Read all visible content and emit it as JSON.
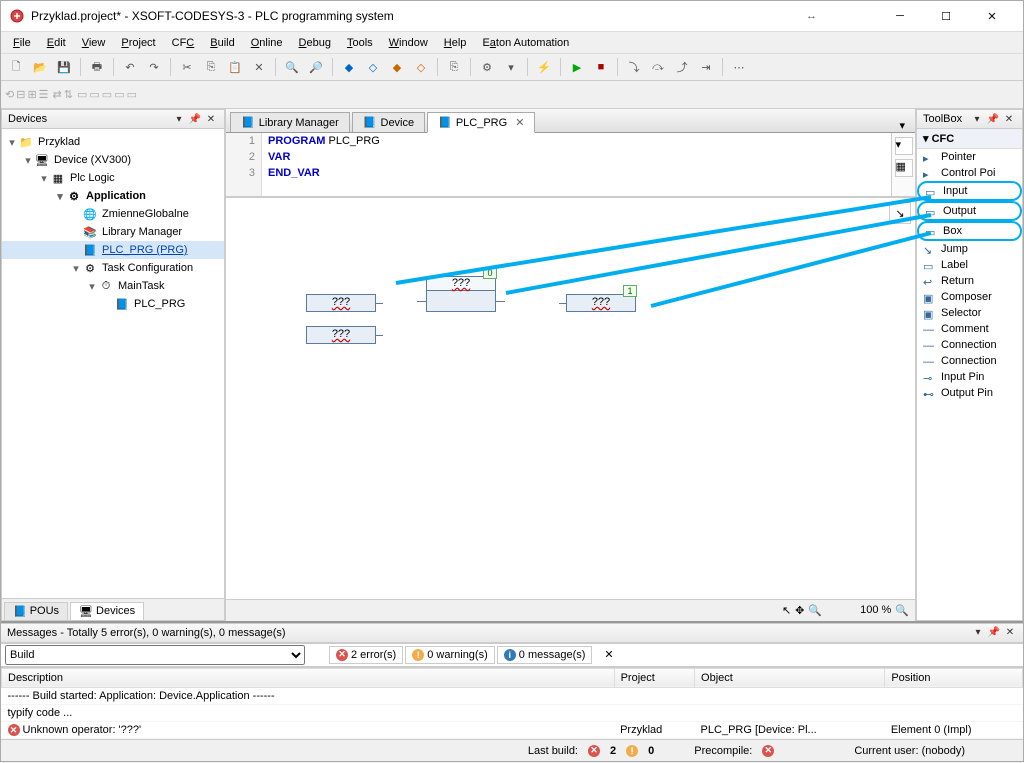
{
  "window": {
    "title": "Przyklad.project* - XSOFT-CODESYS-3 - PLC programming system"
  },
  "menus": [
    "File",
    "Edit",
    "View",
    "Project",
    "CFC",
    "Build",
    "Online",
    "Debug",
    "Tools",
    "Window",
    "Help",
    "Eaton Automation"
  ],
  "devices": {
    "title": "Devices",
    "tree": [
      {
        "label": "Przyklad",
        "indent": 0,
        "icon": "project",
        "tw": "▾"
      },
      {
        "label": "Device (XV300)",
        "indent": 1,
        "icon": "device",
        "tw": "▾"
      },
      {
        "label": "Plc Logic",
        "indent": 2,
        "icon": "plc",
        "tw": "▾"
      },
      {
        "label": "Application",
        "indent": 3,
        "icon": "app",
        "tw": "▾",
        "bold": true
      },
      {
        "label": "ZmienneGlobalne",
        "indent": 4,
        "icon": "globe",
        "tw": ""
      },
      {
        "label": "Library Manager",
        "indent": 4,
        "icon": "lib",
        "tw": ""
      },
      {
        "label": "PLC_PRG (PRG)",
        "indent": 4,
        "icon": "pou",
        "tw": "",
        "selected": true,
        "link": true
      },
      {
        "label": "Task Configuration",
        "indent": 4,
        "icon": "task",
        "tw": "▾"
      },
      {
        "label": "MainTask",
        "indent": 5,
        "icon": "mtask",
        "tw": "▾"
      },
      {
        "label": "PLC_PRG",
        "indent": 6,
        "icon": "pou",
        "tw": ""
      }
    ],
    "tabs": [
      "POUs",
      "Devices"
    ]
  },
  "editor": {
    "tabs": [
      {
        "label": "Library Manager",
        "active": false
      },
      {
        "label": "Device",
        "active": false
      },
      {
        "label": "PLC_PRG",
        "active": true,
        "closable": true
      }
    ],
    "code": {
      "lines": [
        {
          "n": 1,
          "html": "<span class='kw-blue'>PROGRAM</span> PLC_PRG"
        },
        {
          "n": 2,
          "html": "<span class='kw-blue'>VAR</span>"
        },
        {
          "n": 3,
          "html": "<span class='kw-blue'>END_VAR</span>"
        }
      ]
    },
    "blocks": {
      "input1": "???",
      "input2": "???",
      "box": "???",
      "boxBadge": "0",
      "output": "???",
      "outBadge": "1"
    },
    "zoom": "100 %"
  },
  "canvas_tools": {
    "pointer": "↖",
    "move": "✥",
    "zoom": "🔍"
  },
  "toolbox": {
    "title": "ToolBox",
    "group": "CFC",
    "items": [
      {
        "label": "Pointer",
        "icon": "▸"
      },
      {
        "label": "Control Poi",
        "icon": "▸"
      },
      {
        "label": "Input",
        "icon": "▭",
        "circled": true
      },
      {
        "label": "Output",
        "icon": "▭",
        "circled": true
      },
      {
        "label": "Box",
        "icon": "▭",
        "circled": true
      },
      {
        "label": "Jump",
        "icon": "↘"
      },
      {
        "label": "Label",
        "icon": "▭"
      },
      {
        "label": "Return",
        "icon": "↩"
      },
      {
        "label": "Composer",
        "icon": "▣"
      },
      {
        "label": "Selector",
        "icon": "▣"
      },
      {
        "label": "Comment",
        "icon": "—"
      },
      {
        "label": "Connection",
        "icon": "—"
      },
      {
        "label": "Connection",
        "icon": "—"
      },
      {
        "label": "Input Pin",
        "icon": "⊸"
      },
      {
        "label": "Output Pin",
        "icon": "⊷"
      }
    ]
  },
  "messages": {
    "title": "Messages - Totally 5 error(s), 0 warning(s), 0 message(s)",
    "build": "Build",
    "errors": "2 error(s)",
    "warnings": "0 warning(s)",
    "infos": "0 message(s)",
    "cols": [
      "Description",
      "Project",
      "Object",
      "Position"
    ],
    "rows": [
      {
        "d": "------ Build started: Application: Device.Application ------",
        "p": "",
        "o": "",
        "pos": ""
      },
      {
        "d": "typify code ...",
        "p": "",
        "o": "",
        "pos": ""
      },
      {
        "d": "Unknown operator: '???'",
        "p": "Przyklad",
        "o": "PLC_PRG [Device: Pl...",
        "pos": "Element 0 (Impl)",
        "err": true
      }
    ]
  },
  "status": {
    "lastbuild": "Last build:",
    "err": "2",
    "warn": "0",
    "precompile": "Precompile:",
    "user": "Current user: (nobody)"
  }
}
